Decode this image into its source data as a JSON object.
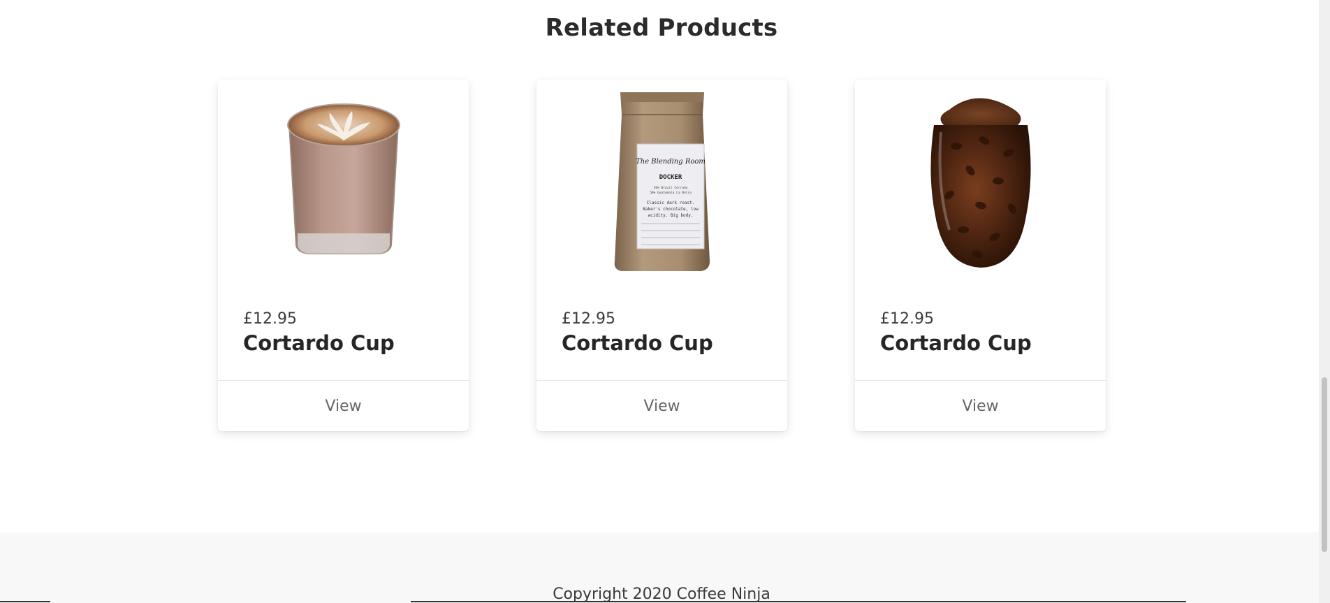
{
  "related": {
    "title": "Related Products",
    "products": [
      {
        "price": "£12.95",
        "name": "Cortardo Cup",
        "action": "View",
        "image": "latte-glass-image"
      },
      {
        "price": "£12.95",
        "name": "Cortardo Cup",
        "action": "View",
        "image": "coffee-bag-image"
      },
      {
        "price": "£12.95",
        "name": "Cortardo Cup",
        "action": "View",
        "image": "coffee-beans-glass-image"
      }
    ]
  },
  "footer": {
    "copyright": "Copyright 2020 Coffee Ninja"
  },
  "coffee_bag": {
    "label_title": "DOCKER",
    "label_brand": "The Blending Room",
    "label_line1": "50% Brazil Cerrado",
    "label_line2": "50% Guatemala La Bolsa",
    "label_notes1": "Classic dark roast.",
    "label_notes2": "Baker's chocolate, low",
    "label_notes3": "acidity. Big body."
  },
  "colors": {
    "accent_text": "#2a2a2a",
    "muted_text": "#666666",
    "footer_bg": "#f8f8f8"
  }
}
